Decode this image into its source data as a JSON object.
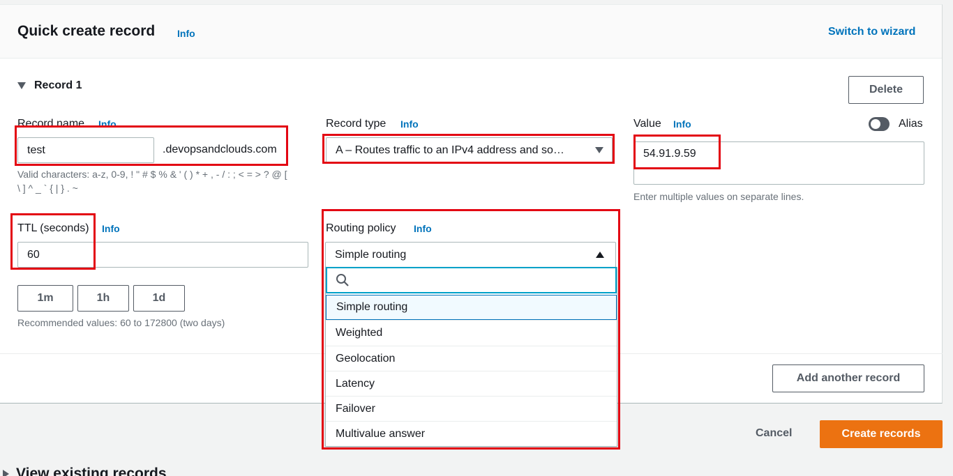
{
  "header": {
    "title": "Quick create record",
    "info": "Info",
    "switch_link": "Switch to wizard"
  },
  "record": {
    "section_title": "Record 1",
    "delete_label": "Delete",
    "name": {
      "label": "Record name",
      "info": "Info",
      "value": "test",
      "suffix": ".devopsandclouds.com",
      "hint_line1": "Valid characters: a-z, 0-9, ! \" # $ % & ' ( ) * + , - / : ; < = > ? @ [",
      "hint_line2": "\\ ] ^ _ ` { | } . ~"
    },
    "type": {
      "label": "Record type",
      "info": "Info",
      "value": "A – Routes traffic to an IPv4 address and so…"
    },
    "value": {
      "label": "Value",
      "info": "Info",
      "alias_label": "Alias",
      "text": "54.91.9.59",
      "hint": "Enter multiple values on separate lines."
    },
    "ttl": {
      "label": "TTL (seconds)",
      "info": "Info",
      "value": "60",
      "presets": [
        "1m",
        "1h",
        "1d"
      ],
      "hint": "Recommended values: 60 to 172800 (two days)"
    },
    "routing": {
      "label": "Routing policy",
      "info": "Info",
      "value": "Simple routing",
      "search_placeholder": "",
      "options": [
        "Simple routing",
        "Weighted",
        "Geolocation",
        "Latency",
        "Failover",
        "Multivalue answer"
      ]
    }
  },
  "footer": {
    "add_record_label": "Add another record",
    "cancel_label": "Cancel",
    "create_label": "Create records",
    "view_existing": "View existing records"
  },
  "colors": {
    "accent": "#0073bb",
    "primary_button": "#ec7211",
    "highlight": "#e30613"
  },
  "icons": [
    "caret-down-icon",
    "chevron-down-icon",
    "caret-up-icon",
    "search-icon",
    "toggle-icon",
    "caret-right-icon"
  ]
}
